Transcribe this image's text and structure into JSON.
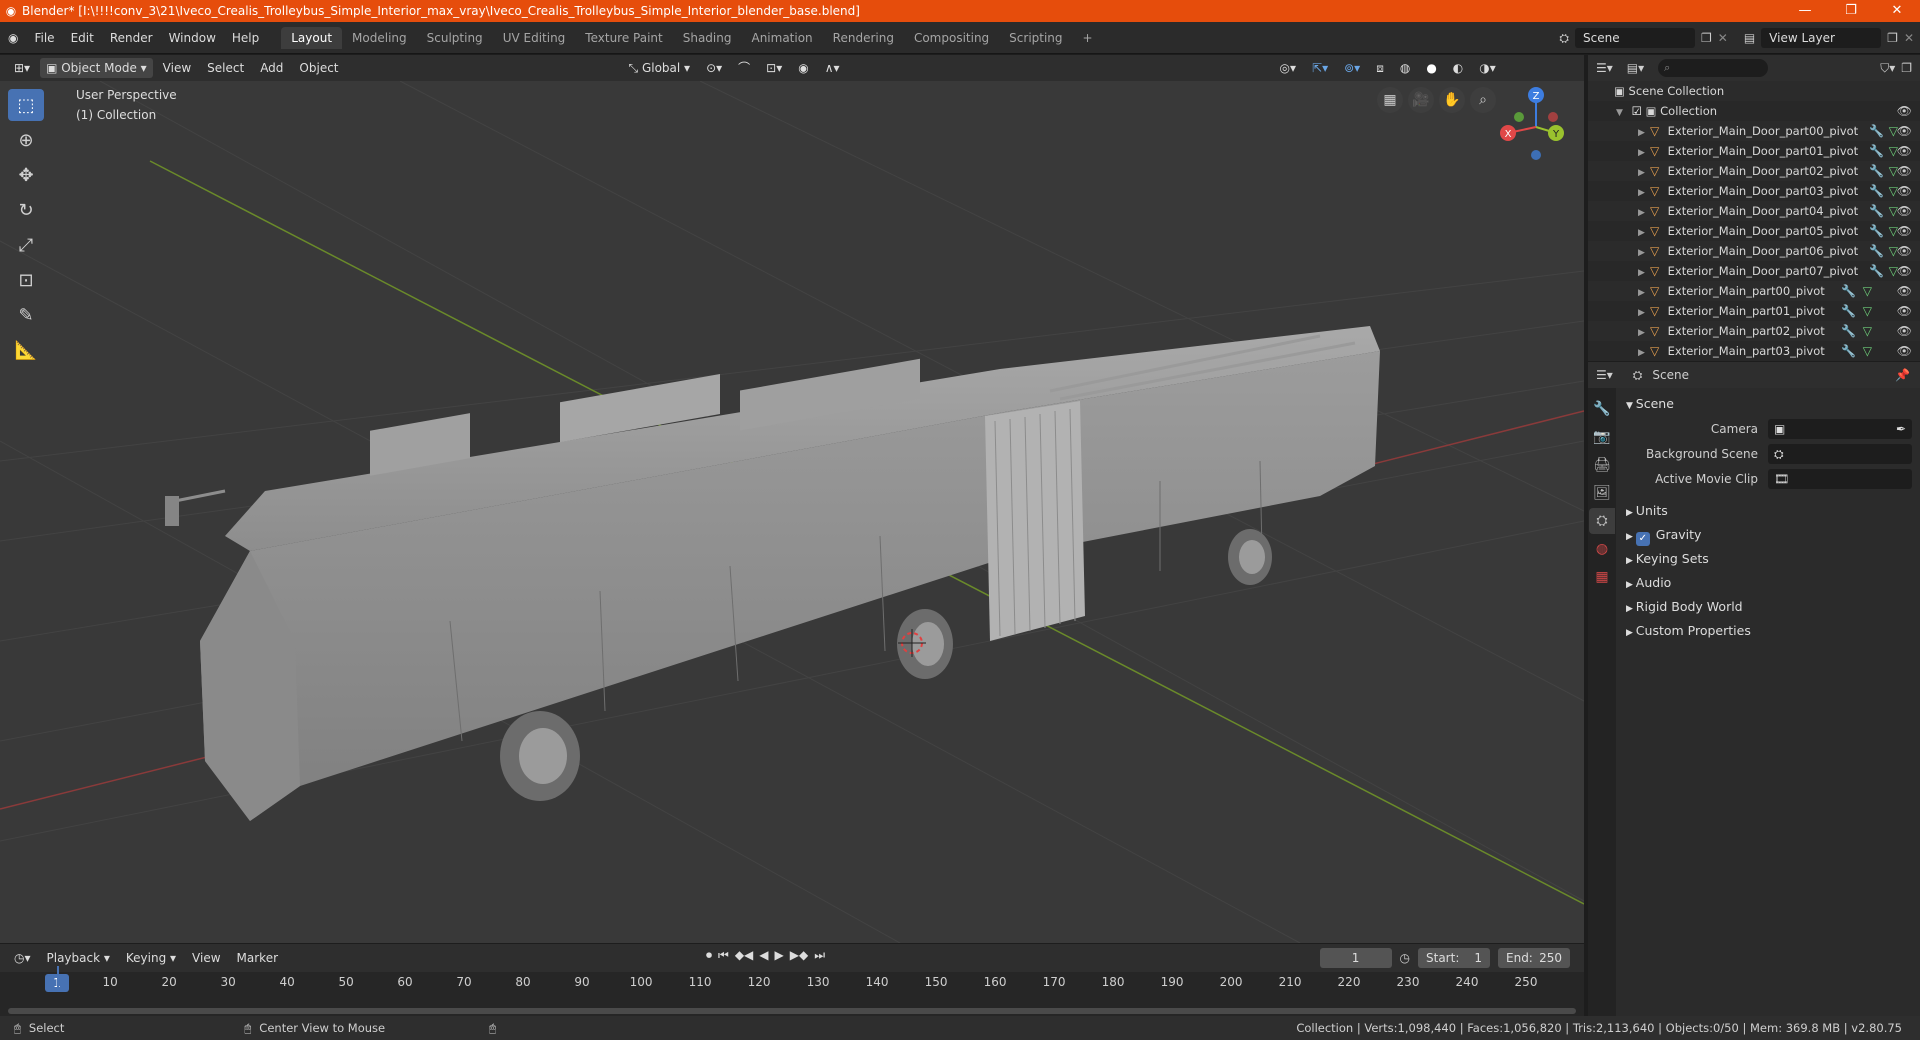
{
  "window": {
    "title": "Blender* [I:\\!!!!conv_3\\21\\Iveco_Crealis_Trolleybus_Simple_Interior_max_vray\\Iveco_Crealis_Trolleybus_Simple_Interior_blender_base.blend]",
    "minimize": "—",
    "maximize": "❐",
    "close": "✕"
  },
  "menu": {
    "items": [
      "File",
      "Edit",
      "Render",
      "Window",
      "Help"
    ],
    "workspaces": [
      "Layout",
      "Modeling",
      "Sculpting",
      "UV Editing",
      "Texture Paint",
      "Shading",
      "Animation",
      "Rendering",
      "Compositing",
      "Scripting"
    ],
    "active_workspace": "Layout",
    "add_workspace": "+",
    "scene": "Scene",
    "view_layer": "View Layer"
  },
  "viewport_header": {
    "mode": "Object Mode",
    "view": "View",
    "select": "Select",
    "add": "Add",
    "object": "Object",
    "orientation": "Global"
  },
  "viewport": {
    "perspective": "User Perspective",
    "collection": "(1) Collection",
    "gizmo": {
      "x": "X",
      "y": "Y",
      "z": "Z"
    }
  },
  "outliner": {
    "scene_collection": "Scene Collection",
    "collection": "Collection",
    "items": [
      {
        "name": "Exterior_Main_Door_part00_pivot"
      },
      {
        "name": "Exterior_Main_Door_part01_pivot"
      },
      {
        "name": "Exterior_Main_Door_part02_pivot"
      },
      {
        "name": "Exterior_Main_Door_part03_pivot"
      },
      {
        "name": "Exterior_Main_Door_part04_pivot"
      },
      {
        "name": "Exterior_Main_Door_part05_pivot"
      },
      {
        "name": "Exterior_Main_Door_part06_pivot"
      },
      {
        "name": "Exterior_Main_Door_part07_pivot"
      },
      {
        "name": "Exterior_Main_part00_pivot"
      },
      {
        "name": "Exterior_Main_part01_pivot"
      },
      {
        "name": "Exterior_Main_part02_pivot"
      },
      {
        "name": "Exterior_Main_part03_pivot"
      }
    ]
  },
  "properties": {
    "header_title": "Scene",
    "section": "Scene",
    "camera_label": "Camera",
    "background_scene_label": "Background Scene",
    "active_movie_clip_label": "Active Movie Clip",
    "panels": [
      "Units",
      "Gravity",
      "Keying Sets",
      "Audio",
      "Rigid Body World",
      "Custom Properties"
    ],
    "gravity_checked": true
  },
  "timeline": {
    "playback": "Playback",
    "keying": "Keying",
    "view": "View",
    "marker": "Marker",
    "current_frame": "1",
    "start_label": "Start:",
    "start": "1",
    "end_label": "End:",
    "end": "250",
    "ticks": [
      "1",
      "10",
      "20",
      "30",
      "40",
      "50",
      "60",
      "70",
      "80",
      "90",
      "100",
      "110",
      "120",
      "130",
      "140",
      "150",
      "160",
      "170",
      "180",
      "190",
      "200",
      "210",
      "220",
      "230",
      "240",
      "250"
    ]
  },
  "status": {
    "select": "Select",
    "center_view": "Center View to Mouse",
    "stats": "Collection | Verts:1,098,440 | Faces:1,056,820 | Tris:2,113,640 | Objects:0/50 | Mem: 369.8 MB | v2.80.75"
  },
  "colors": {
    "accent": "#4772b3",
    "title_bar": "#e64d0c",
    "object_icon": "#e59f4f"
  }
}
